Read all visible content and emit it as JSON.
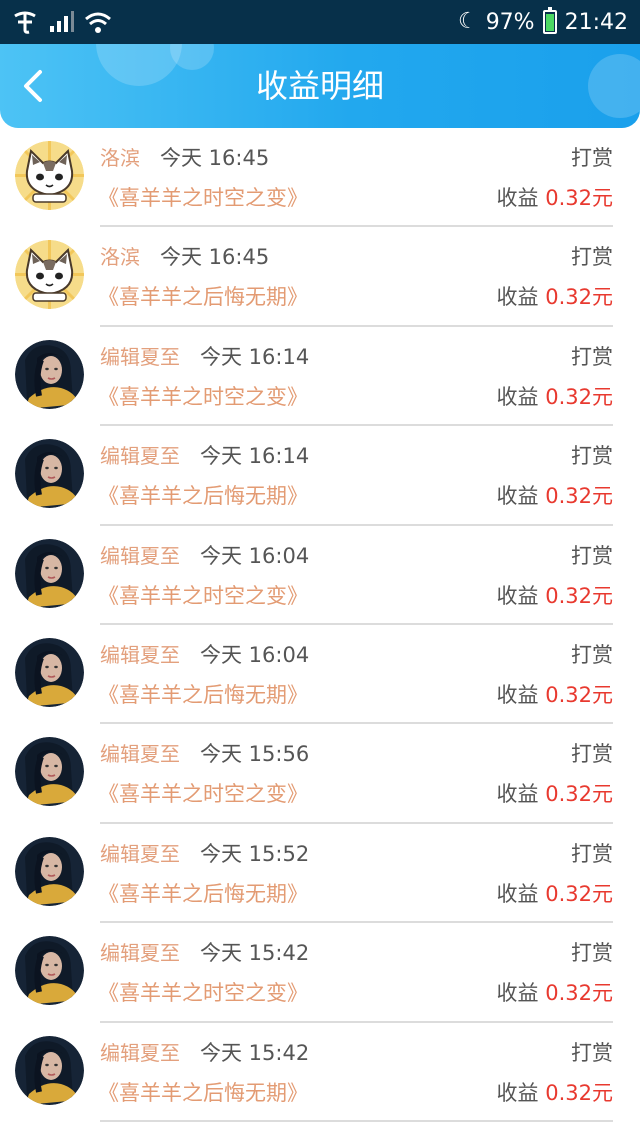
{
  "status_bar": {
    "battery_percent": "97%",
    "time": "21:42",
    "icons": [
      "carrier-icon",
      "signal-icon",
      "wifi-icon",
      "moon-icon",
      "battery-icon"
    ]
  },
  "header": {
    "title": "收益明细",
    "back_icon": "chevron-left-icon"
  },
  "colors": {
    "header_start": "#4dc3f5",
    "header_end": "#1aa0ec",
    "name": "#e3a07d",
    "book": "#e39b73",
    "amount": "#e8392f",
    "statusbar": "#07304a"
  },
  "records": [
    {
      "avatar": "cat-avatar",
      "name": "洛滨",
      "time": "今天 16:45",
      "type": "打赏",
      "book": "《喜羊羊之时空之变》",
      "income_label": "收益",
      "amount": "0.32元"
    },
    {
      "avatar": "cat-avatar",
      "name": "洛滨",
      "time": "今天 16:45",
      "type": "打赏",
      "book": "《喜羊羊之后悔无期》",
      "income_label": "收益",
      "amount": "0.32元"
    },
    {
      "avatar": "woman-avatar",
      "name": "编辑夏至",
      "time": "今天 16:14",
      "type": "打赏",
      "book": "《喜羊羊之时空之变》",
      "income_label": "收益",
      "amount": "0.32元"
    },
    {
      "avatar": "woman-avatar",
      "name": "编辑夏至",
      "time": "今天 16:14",
      "type": "打赏",
      "book": "《喜羊羊之后悔无期》",
      "income_label": "收益",
      "amount": "0.32元"
    },
    {
      "avatar": "woman-avatar",
      "name": "编辑夏至",
      "time": "今天 16:04",
      "type": "打赏",
      "book": "《喜羊羊之时空之变》",
      "income_label": "收益",
      "amount": "0.32元"
    },
    {
      "avatar": "woman-avatar",
      "name": "编辑夏至",
      "time": "今天 16:04",
      "type": "打赏",
      "book": "《喜羊羊之后悔无期》",
      "income_label": "收益",
      "amount": "0.32元"
    },
    {
      "avatar": "woman-avatar",
      "name": "编辑夏至",
      "time": "今天 15:56",
      "type": "打赏",
      "book": "《喜羊羊之时空之变》",
      "income_label": "收益",
      "amount": "0.32元"
    },
    {
      "avatar": "woman-avatar",
      "name": "编辑夏至",
      "time": "今天 15:52",
      "type": "打赏",
      "book": "《喜羊羊之后悔无期》",
      "income_label": "收益",
      "amount": "0.32元"
    },
    {
      "avatar": "woman-avatar",
      "name": "编辑夏至",
      "time": "今天 15:42",
      "type": "打赏",
      "book": "《喜羊羊之时空之变》",
      "income_label": "收益",
      "amount": "0.32元"
    },
    {
      "avatar": "woman-avatar",
      "name": "编辑夏至",
      "time": "今天 15:42",
      "type": "打赏",
      "book": "《喜羊羊之后悔无期》",
      "income_label": "收益",
      "amount": "0.32元"
    }
  ]
}
